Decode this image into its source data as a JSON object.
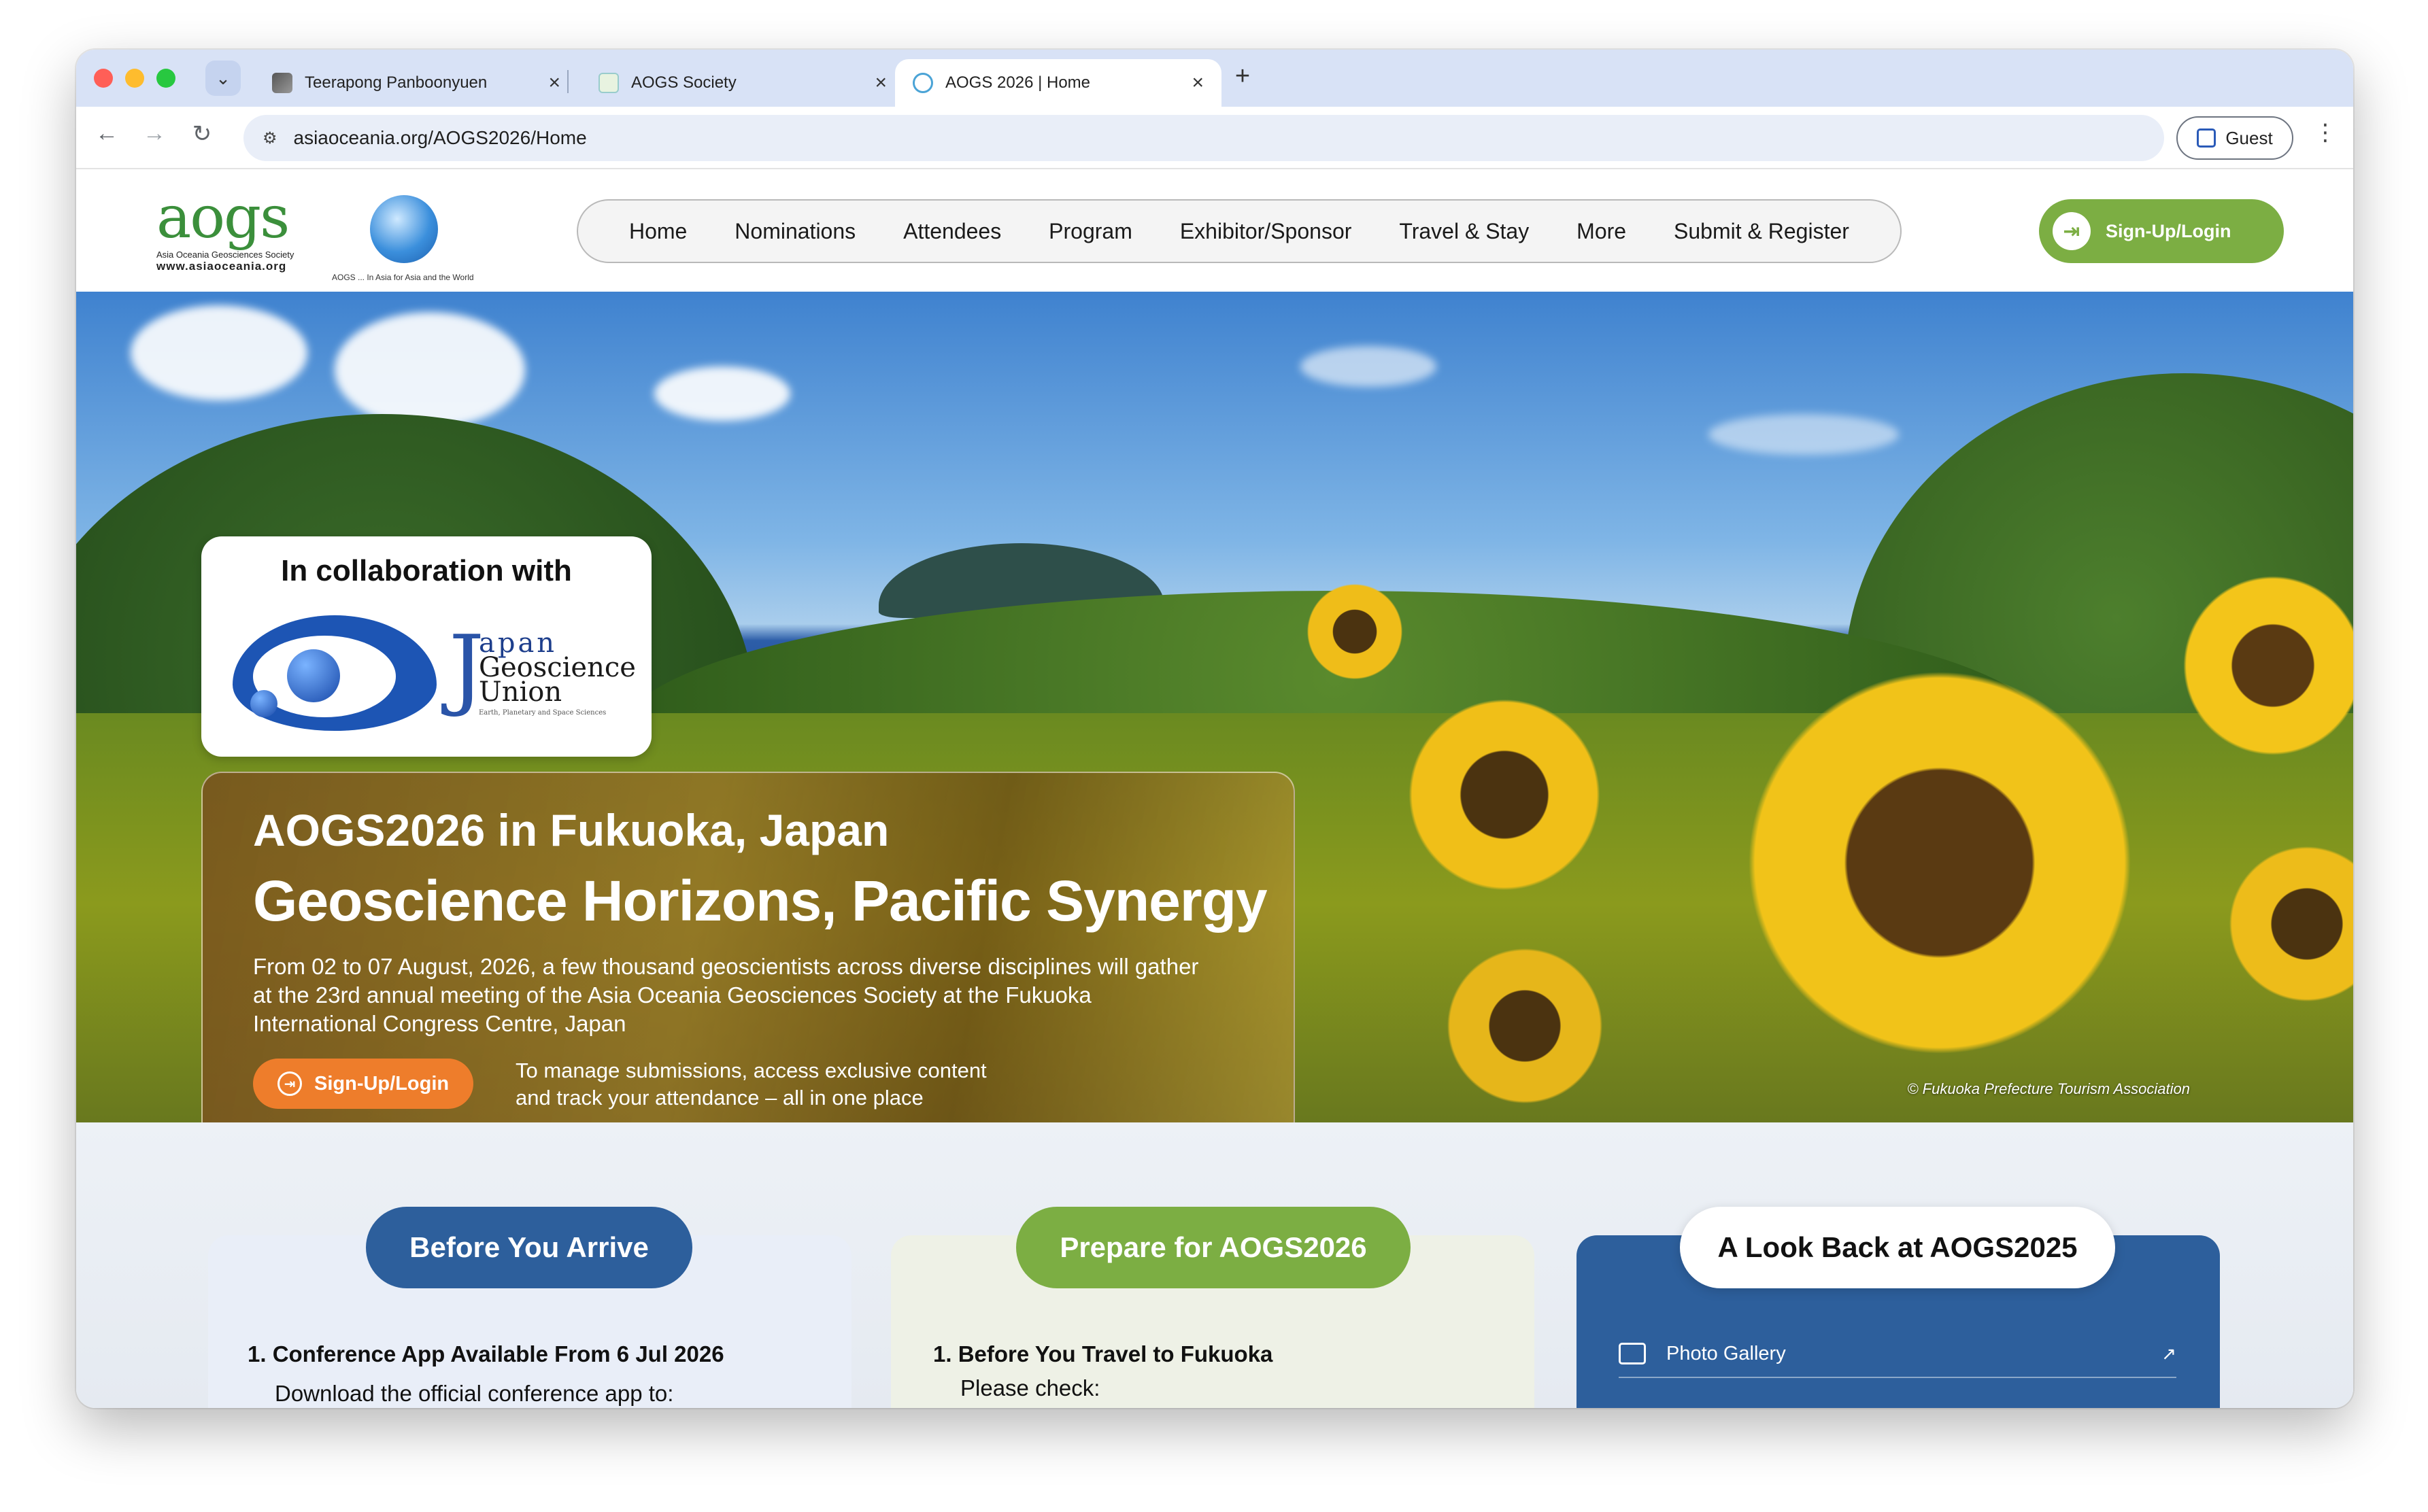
{
  "browser": {
    "tabs": [
      {
        "title": "Teerapong Panboonyuen"
      },
      {
        "title": "AOGS Society"
      },
      {
        "title": "AOGS 2026 | Home",
        "active": true
      }
    ],
    "new_tab": "+",
    "close_glyph": "×",
    "url": "asiaoceania.org/AOGS2026/Home",
    "profile": "Guest"
  },
  "site": {
    "logo": {
      "mark": "aogs",
      "line1": "Asia Oceania Geosciences Society",
      "line2": "www.asiaoceania.org",
      "globe_caption": "AOGS ... In Asia for Asia and the World"
    },
    "nav": [
      "Home",
      "Nominations",
      "Attendees",
      "Program",
      "Exhibitor/Sponsor",
      "Travel & Stay",
      "More",
      "Submit & Register"
    ],
    "signup_label": "Sign-Up/Login",
    "accent_green": "#7cae43",
    "accent_blue": "#2d5f9c",
    "accent_orange": "#ee7d2b"
  },
  "hero": {
    "collab_title": "In collaboration with",
    "jgu": {
      "j": "J",
      "line1": "apan",
      "line2": "Geoscience",
      "line3": "Union",
      "tagline": "Earth, Planetary and Space Sciences"
    },
    "title": "AOGS2026 in Fukuoka, Japan",
    "headline": "Geoscience Horizons, Pacific Synergy",
    "description": "From 02 to 07 August, 2026, a few thousand geoscientists across diverse disciplines will gather at the 23rd annual meeting of the Asia Oceania Geosciences Society at the Fukuoka International Congress Centre, Japan",
    "cta": "Sign-Up/Login",
    "cta_note_1": "To manage submissions, access exclusive content",
    "cta_note_2": "and track your attendance – all in one place",
    "credit": "© Fukuoka Prefecture Tourism Association"
  },
  "sections": {
    "before": {
      "title": "Before You Arrive",
      "item1": "1. Conference App Available From 6 Jul 2026",
      "item1_sub": "Download the official conference app to:"
    },
    "prepare": {
      "title": "Prepare for AOGS2026",
      "item1": "1. Before You Travel to Fukuoka",
      "item1_sub": "Please check:"
    },
    "lookback": {
      "title": "A Look Back at AOGS2025",
      "item1": "Photo Gallery",
      "item1_arrow": "↗"
    }
  }
}
